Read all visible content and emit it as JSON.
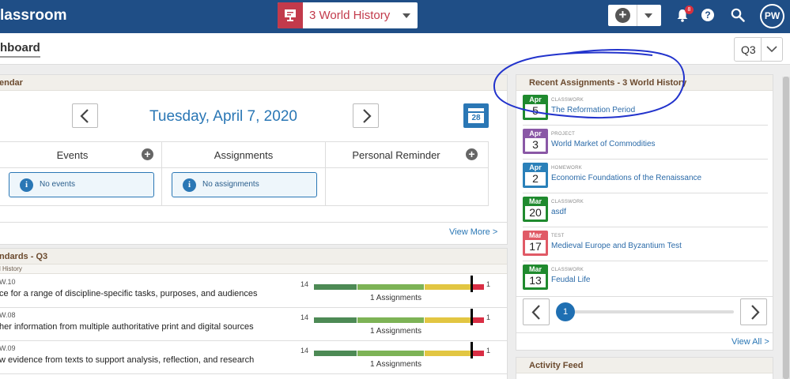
{
  "header": {
    "brand": "lassroom",
    "class_selector": "3 World History",
    "notification_count": "8",
    "avatar_initials": "PW"
  },
  "subheader": {
    "page_title": "hboard",
    "quarter": "Q3"
  },
  "calendar": {
    "panel_title": "endar",
    "date": "Tuesday, April 7, 2020",
    "calendar_icon_day": "28",
    "columns": [
      {
        "label": "Events",
        "empty_text": "No events"
      },
      {
        "label": "Assignments",
        "empty_text": "No assignments"
      },
      {
        "label": "Personal Reminder"
      }
    ],
    "view_more": "View More >"
  },
  "standards": {
    "panel_title": "ndards - Q3",
    "subtitle": "l History",
    "rows": [
      {
        "code": "W.10",
        "description": "ce for a range of discipline-specific tasks, purposes, and audiences",
        "left_count": "14",
        "right_count": "1",
        "assignments": "1 Assignments"
      },
      {
        "code": "W.08",
        "description": "her information from multiple authoritative print and digital sources",
        "left_count": "14",
        "right_count": "1",
        "assignments": "1 Assignments"
      },
      {
        "code": "W.09",
        "description": "w evidence from texts to support analysis, reflection, and research",
        "left_count": "14",
        "right_count": "1",
        "assignments": "1 Assignments"
      }
    ]
  },
  "recent_assignments": {
    "panel_title": "Recent Assignments - 3 World History",
    "items": [
      {
        "month": "Apr",
        "day": "5",
        "type": "CLASSWORK",
        "title": "The Reformation Period",
        "color": "#1f8a2e"
      },
      {
        "month": "Apr",
        "day": "3",
        "type": "PROJECT",
        "title": "World Market of Commodities",
        "color": "#8a58a6"
      },
      {
        "month": "Apr",
        "day": "2",
        "type": "HOMEWORK",
        "title": "Economic Foundations of the Renaissance",
        "color": "#2a80b9"
      },
      {
        "month": "Mar",
        "day": "20",
        "type": "CLASSWORK",
        "title": "asdf",
        "color": "#1f8a2e"
      },
      {
        "month": "Mar",
        "day": "17",
        "type": "TEST",
        "title": "Medieval Europe and Byzantium Test",
        "color": "#e05a66"
      },
      {
        "month": "Mar",
        "day": "13",
        "type": "CLASSWORK",
        "title": "Feudal Life",
        "color": "#1f8a2e"
      }
    ],
    "page": "1",
    "view_all": "View All >"
  },
  "activity_feed": {
    "panel_title": "Activity Feed"
  },
  "colors": {
    "topbar": "#1f4e86",
    "accent_blue": "#2a77b5",
    "bar_dark_green": "#4d8a55",
    "bar_light_green": "#7db356",
    "bar_yellow": "#e2c642",
    "bar_red": "#d92e44",
    "annotation": "#2233cc"
  }
}
